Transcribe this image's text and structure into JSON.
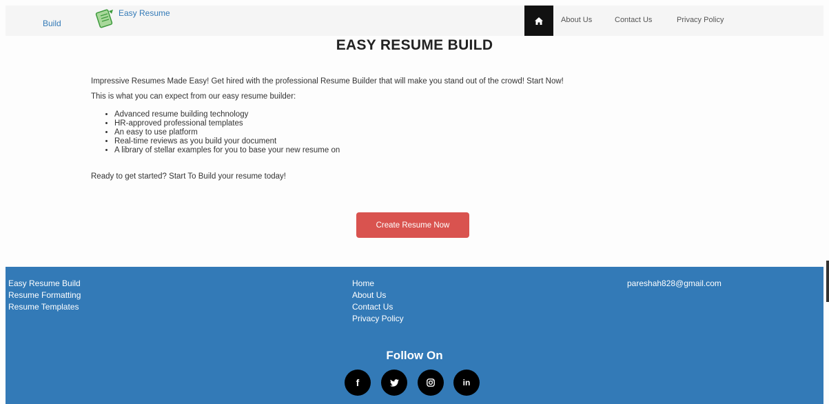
{
  "navbar": {
    "brand_text": "Build",
    "logo_text": "Easy Resume",
    "home_icon": "home-icon",
    "links": [
      "About Us",
      "Contact Us",
      "Privacy Policy"
    ]
  },
  "main": {
    "title": "EASY RESUME BUILD",
    "intro": "Impressive Resumes Made Easy! Get hired with the professional Resume Builder that will make you stand out of the crowd! Start Now!",
    "expect": "This is what you can expect from our easy resume builder:",
    "features": [
      "Advanced resume building technology",
      "HR-approved professional templates",
      "An easy to use platform",
      "Real-time reviews as you build your document",
      "A library of stellar examples for you to base your new resume on"
    ],
    "ready": "Ready to get started? Start To Build your resume today!",
    "create_button": "Create Resume Now"
  },
  "footer": {
    "col1": [
      "Easy Resume Build",
      "Resume Formatting",
      "Resume Templates"
    ],
    "col2": [
      "Home",
      "About Us",
      "Contact Us",
      "Privacy Policy"
    ],
    "email": "pareshah828@gmail.com",
    "follow_title": "Follow On",
    "social": [
      {
        "icon": "facebook-icon",
        "glyph": "f"
      },
      {
        "icon": "twitter-icon",
        "glyph": "❧"
      },
      {
        "icon": "instagram-icon",
        "glyph": "◎"
      },
      {
        "icon": "linkedin-icon",
        "glyph": "in"
      }
    ]
  },
  "colors": {
    "footer_bg": "#337ab7",
    "button_bg": "#d9534f",
    "home_bg": "#111111",
    "link": "#337ab7"
  }
}
